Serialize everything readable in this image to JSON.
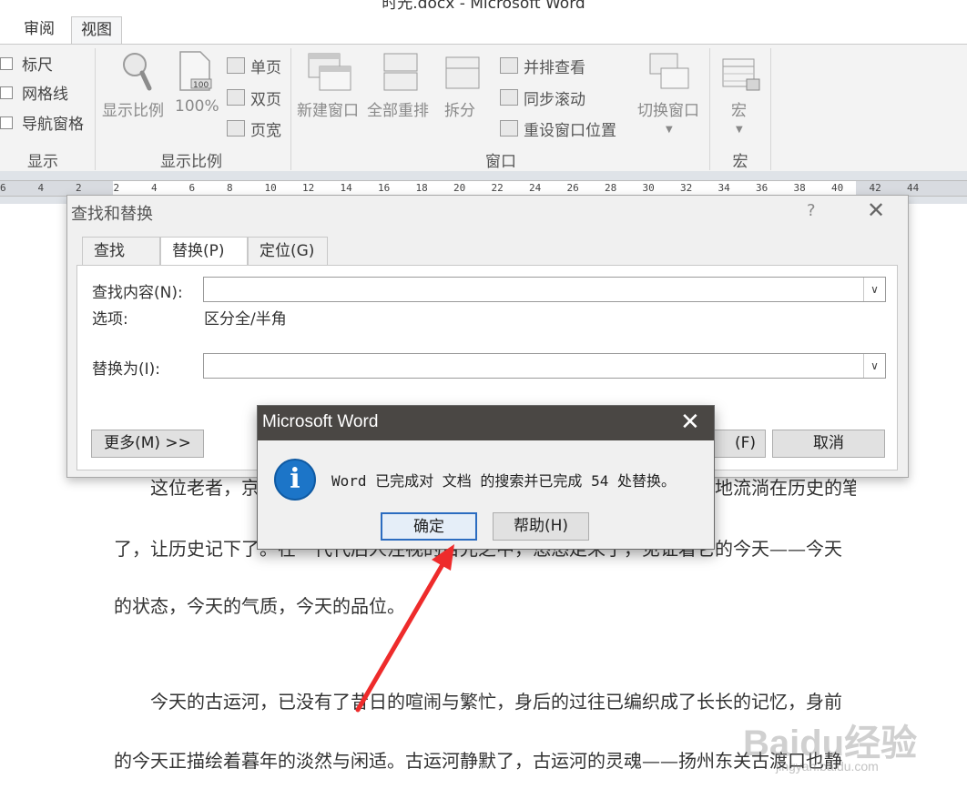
{
  "window": {
    "title": "时光.docx - Microsoft Word"
  },
  "tabs": [
    {
      "label": "审阅"
    },
    {
      "label": "视图"
    }
  ],
  "ribbon": {
    "show_group": {
      "label": "显示",
      "items": [
        {
          "label": "标尺"
        },
        {
          "label": "网格线"
        },
        {
          "label": "导航窗格"
        }
      ]
    },
    "zoom_group": {
      "label": "显示比例",
      "zoom_label": "显示比例",
      "hundred_label": "100%",
      "icon_badge": "100",
      "single_page": "单页",
      "two_pages": "双页",
      "page_width": "页宽"
    },
    "window_group": {
      "label": "窗口",
      "new_window": "新建窗口",
      "arrange_all": "全部重排",
      "split": "拆分",
      "side_by_side": "并排查看",
      "sync_scroll": "同步滚动",
      "reset_position": "重设窗口位置",
      "switch_windows": "切换窗口"
    },
    "macro_group": {
      "label": "宏",
      "macros": "宏"
    }
  },
  "ruler": {
    "ticks": [
      "6",
      "4",
      "2",
      "2",
      "4",
      "6",
      "8",
      "10",
      "12",
      "14",
      "16",
      "18",
      "20",
      "22",
      "24",
      "26",
      "28",
      "30",
      "32",
      "34",
      "36",
      "38",
      "40",
      "42",
      "44"
    ]
  },
  "document": {
    "paragraphs": [
      "这位老者，京杭大运河，千百年来经历了多少时代的变迁与沧桑，默默地流淌在历史的笔下，让时代记住",
      "了，让历史记下了。在一代代后人注视的目光之中，悠悠走来了，见证着它的今天——今天",
      "的状态，今天的气质，今天的品位。",
      "今天的古运河，已没有了昔日的喧闹与繁忙，身后的过往已编织成了长长的记忆，身前",
      "的今天正描绘着暮年的淡然与闲适。古运河静默了，古运河的灵魂——扬州东关古渡口也静"
    ]
  },
  "find_dialog": {
    "title": "查找和替换",
    "help": "?",
    "tabs": [
      {
        "label": "查找(D)"
      },
      {
        "label": "替换(P)"
      },
      {
        "label": "定位(G)"
      }
    ],
    "find_label": "查找内容(N):",
    "find_value": "",
    "options_label": "选项:",
    "options_value": "区分全/半角",
    "replace_label": "替换为(I):",
    "replace_value": "",
    "more_button": "更多(M) >>",
    "find_next_partial": "(F)",
    "cancel_button": "取消"
  },
  "message_box": {
    "title": "Microsoft Word",
    "icon": "info-icon",
    "message": "Word 已完成对 文档 的搜索并已完成 54 处替换。",
    "ok_button": "确定",
    "help_button": "帮助(H)"
  },
  "annotation": {
    "color": "#ee2b2b"
  },
  "watermark": {
    "text": "Baidu经验",
    "sub": "jingyan.baidu.com"
  }
}
